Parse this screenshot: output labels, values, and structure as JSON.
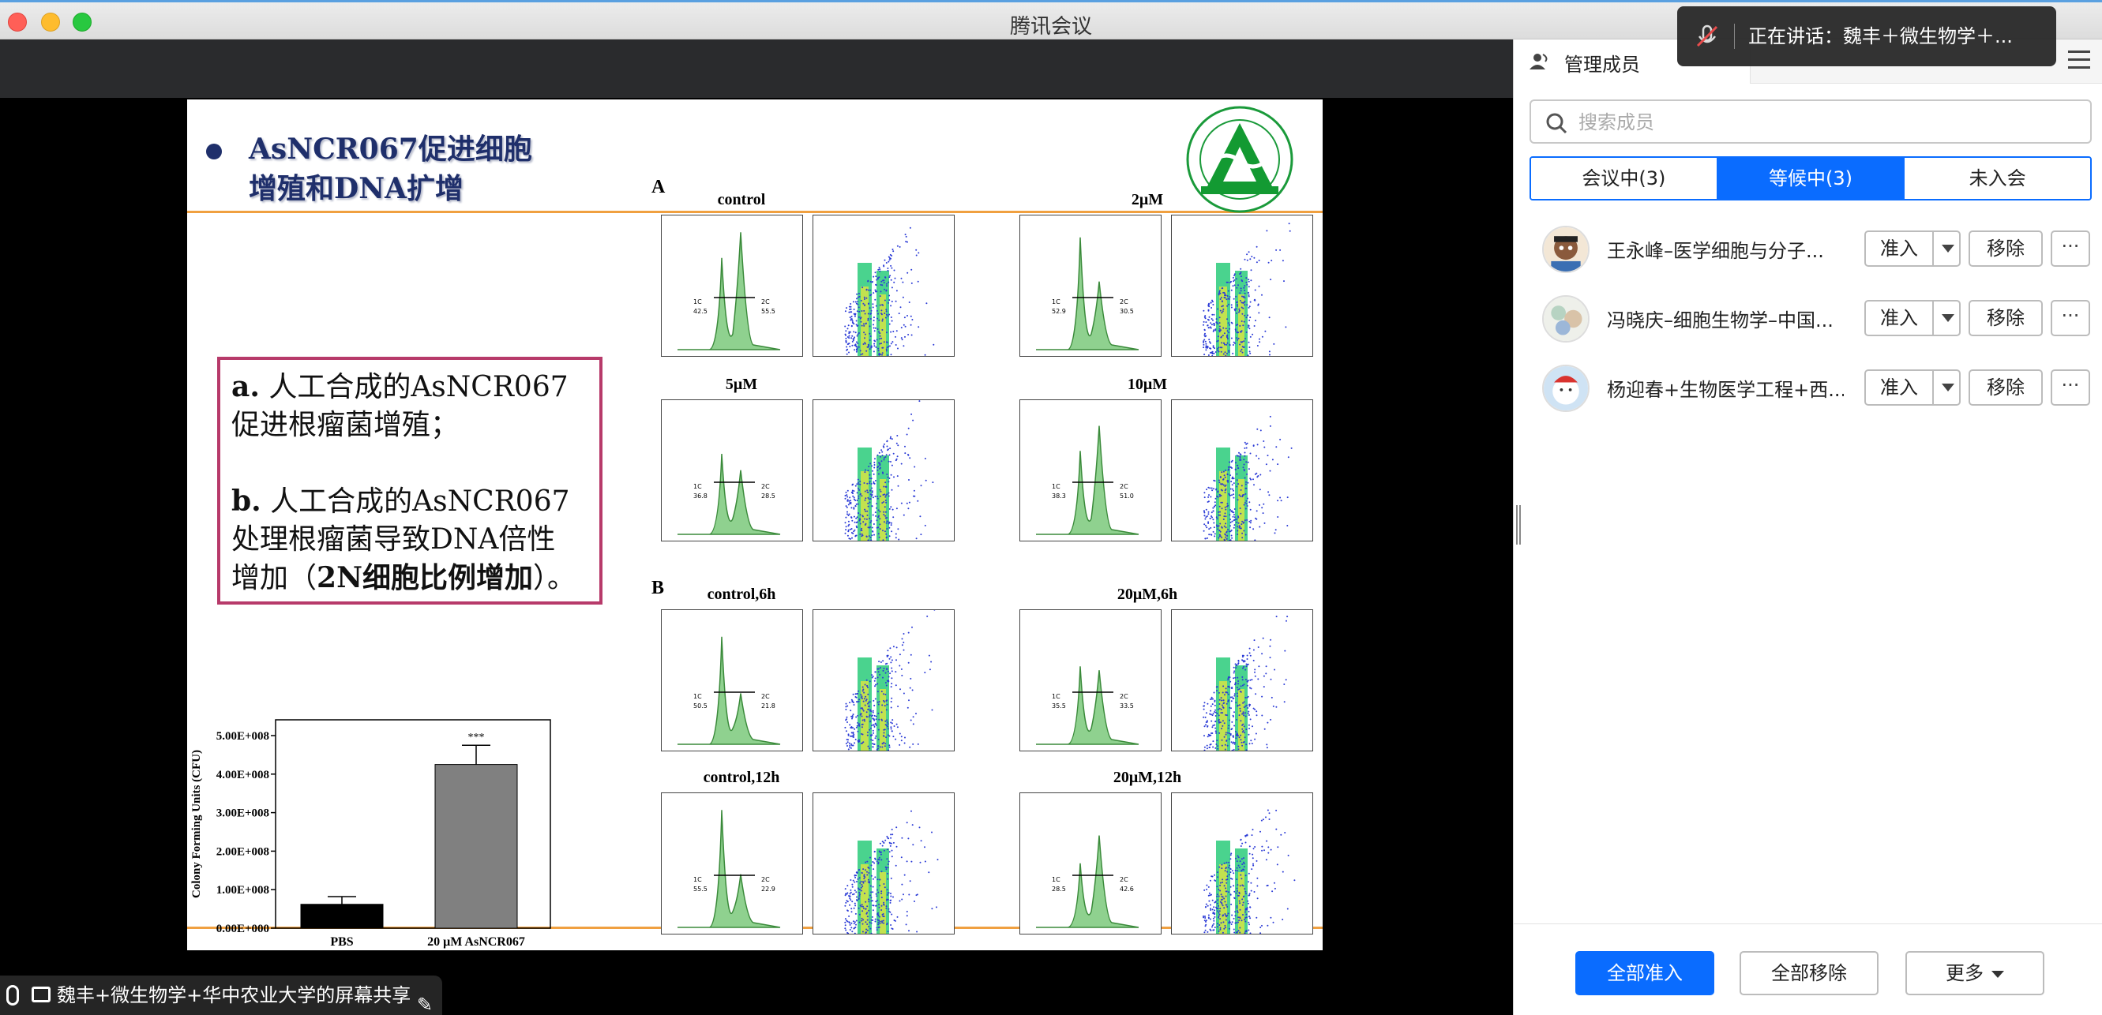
{
  "window": {
    "title": "腾讯会议"
  },
  "share_label": "魏丰+微生物学+华中农业大学的屏幕共享",
  "speaking": "正在讲话：魏丰＋微生物学＋...",
  "panel": {
    "tab_label": "管理成员",
    "search_placeholder": "搜索成员",
    "tabs": [
      {
        "label": "会议中(3)",
        "active": false
      },
      {
        "label": "等候中(3)",
        "active": true
      },
      {
        "label": "未入会",
        "active": false
      }
    ],
    "members": [
      {
        "name": "王永峰–医学细胞与分子...",
        "admit": "准入",
        "remove": "移除",
        "more": "···"
      },
      {
        "name": "冯晓庆–细胞生物学–中国...",
        "admit": "准入",
        "remove": "移除",
        "more": "···"
      },
      {
        "name": "杨迎春+生物医学工程+西...",
        "admit": "准入",
        "remove": "移除",
        "more": "···"
      }
    ],
    "footer": {
      "admit_all": "全部准入",
      "remove_all": "全部移除",
      "more": "更多"
    }
  },
  "slide": {
    "title_line1": "AsNCR067促进细胞",
    "title_line2": "增殖和DNA扩增",
    "text": {
      "a_label": "a.",
      "a_line1": "人工合成的AsNCR067",
      "a_line2": "促进根瘤菌增殖；",
      "b_label": "b.",
      "b_line1": "人工合成的AsNCR067",
      "b_line2": "处理根瘤菌导致DNA倍性",
      "b_line3_prefix": "增加（",
      "b_line3_bold": "2N细胞比例增加",
      "b_line3_suffix": "）。"
    },
    "panel_a_letter": "A",
    "panel_b_letter": "B",
    "flow": [
      {
        "title": "control",
        "g1": "42.5",
        "g2": "55.5"
      },
      {
        "title": "2μM",
        "g1": "52.9",
        "g2": "30.5"
      },
      {
        "title": "5μM",
        "g1": "36.8",
        "g2": "28.5"
      },
      {
        "title": "10μM",
        "g1": "38.3",
        "g2": "51.0"
      },
      {
        "title": "control,6h",
        "g1": "50.5",
        "g2": "21.8"
      },
      {
        "title": "20μM,6h",
        "g1": "35.5",
        "g2": "33.5"
      },
      {
        "title": "control,12h",
        "g1": "55.5",
        "g2": "22.9"
      },
      {
        "title": "20μM,12h",
        "g1": "28.5",
        "g2": "42.6"
      }
    ],
    "flow_gate_labels": {
      "left": "1C",
      "right": "2C"
    }
  },
  "chart_data": {
    "type": "bar",
    "categories": [
      "PBS",
      "20 μM AsNCR067"
    ],
    "values": [
      62000000,
      425000000
    ],
    "errors": [
      20000000,
      50000000
    ],
    "ylabel": "Colony Forming Units (CFU)",
    "ylim": [
      0,
      500000000
    ],
    "yticks": [
      "0.00E+000",
      "1.00E+008",
      "2.00E+008",
      "3.00E+008",
      "4.00E+008",
      "5.00E+008"
    ],
    "significance": "***",
    "colors": [
      "#000000",
      "#808080"
    ]
  }
}
